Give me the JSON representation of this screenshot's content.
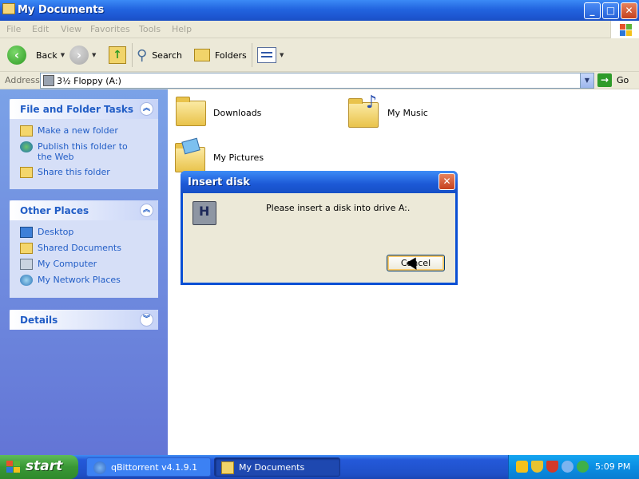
{
  "window": {
    "title": "My Documents",
    "menu": [
      "File",
      "Edit",
      "View",
      "Favorites",
      "Tools",
      "Help"
    ]
  },
  "toolbar": {
    "back_label": "Back",
    "search_label": "Search",
    "folders_label": "Folders"
  },
  "address": {
    "label": "Address",
    "value": "3½ Floppy (A:)",
    "go_label": "Go"
  },
  "sidebar": {
    "tasks_title": "File and Folder Tasks",
    "tasks": [
      {
        "label": "Make a new folder",
        "icon": "new-folder-icon"
      },
      {
        "label": "Publish this folder to the Web",
        "icon": "publish-web-icon"
      },
      {
        "label": "Share this folder",
        "icon": "share-folder-icon"
      }
    ],
    "places_title": "Other Places",
    "places": [
      {
        "label": "Desktop",
        "icon": "desktop-icon"
      },
      {
        "label": "Shared Documents",
        "icon": "folder-icon"
      },
      {
        "label": "My Computer",
        "icon": "computer-icon"
      },
      {
        "label": "My Network Places",
        "icon": "network-icon"
      }
    ],
    "details_title": "Details"
  },
  "folders": [
    {
      "label": "Downloads",
      "icon": "folder-icon"
    },
    {
      "label": "My Music",
      "icon": "music-folder-icon"
    },
    {
      "label": "My Pictures",
      "icon": "pictures-folder-icon"
    }
  ],
  "dialog": {
    "title": "Insert disk",
    "message": "Please insert a disk into drive A:.",
    "cancel_label": "Cancel"
  },
  "taskbar": {
    "start_label": "start",
    "tasks": [
      {
        "label": "qBittorrent v4.1.9.1",
        "active": false
      },
      {
        "label": "My Documents",
        "active": true
      }
    ],
    "clock": "5:09 PM"
  },
  "colors": {
    "titlebar_blue": "#2264df",
    "link_blue": "#215dc6",
    "start_green": "#399735",
    "tray_blue": "#0b8ee3"
  }
}
